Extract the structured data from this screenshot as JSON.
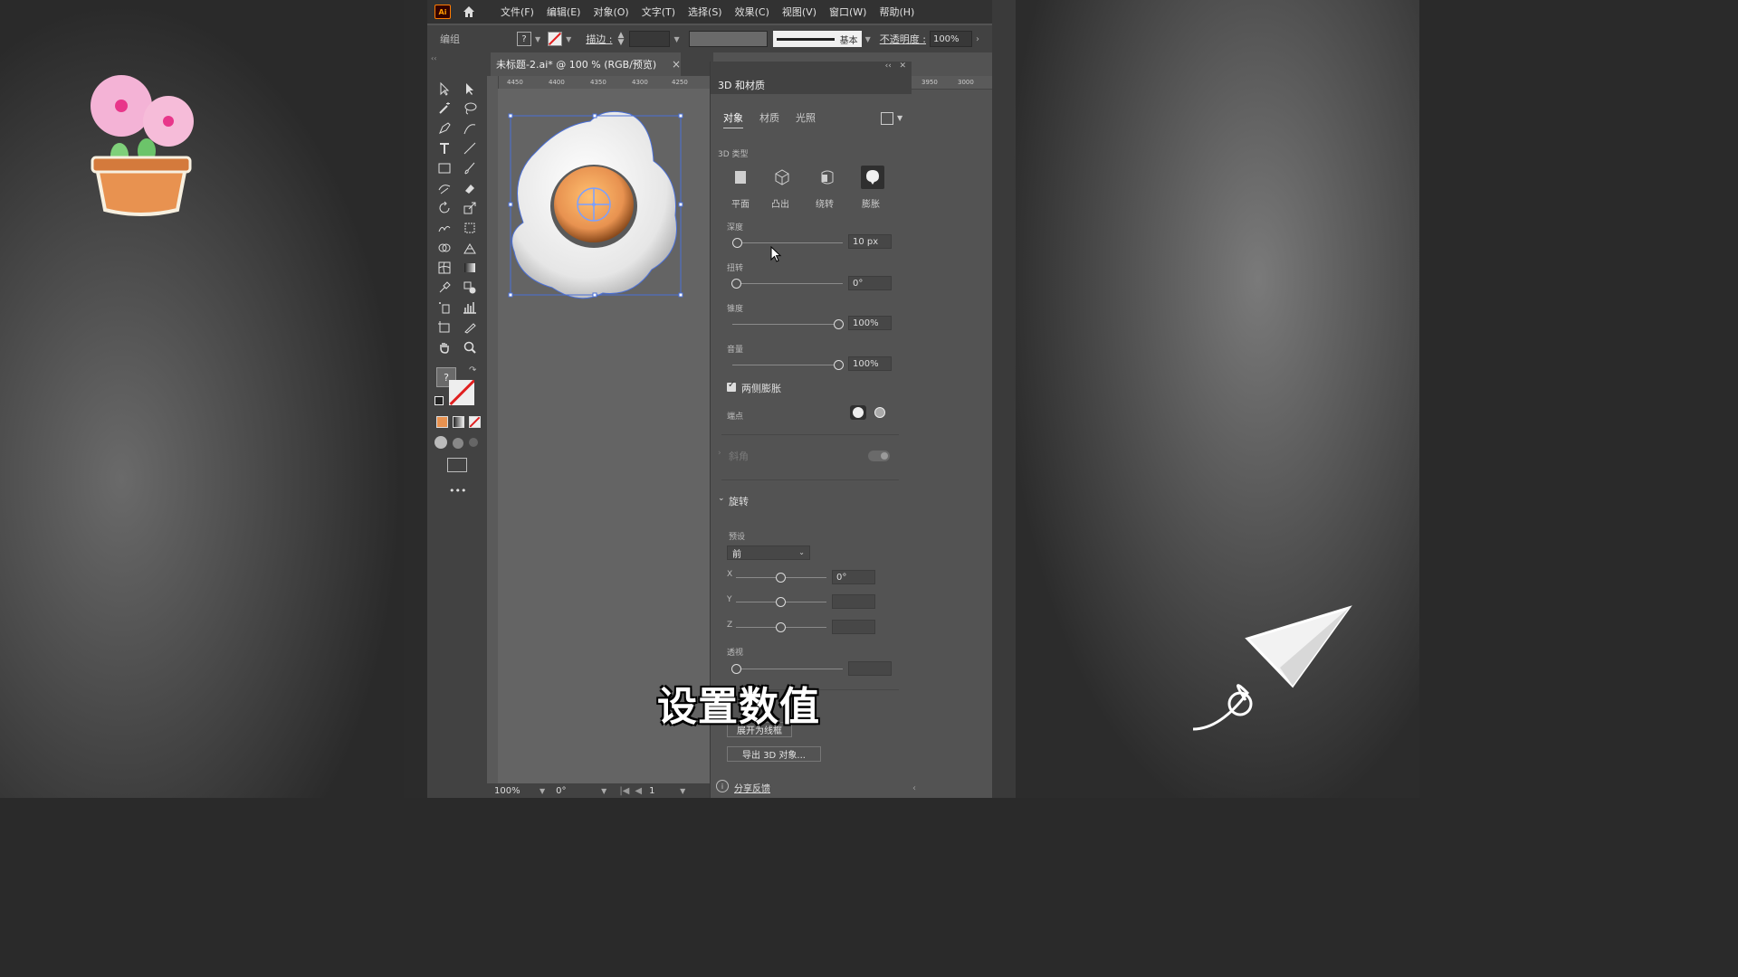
{
  "app": {
    "logo": "Ai",
    "menu": [
      "文件(F)",
      "编辑(E)",
      "对象(O)",
      "文字(T)",
      "选择(S)",
      "效果(C)",
      "视图(V)",
      "窗口(W)",
      "帮助(H)"
    ]
  },
  "control_bar": {
    "selection_label": "编组",
    "question": "?",
    "stroke_label": "描边 :",
    "stroke_style": "基本",
    "opacity_label": "不透明度 :",
    "opacity_value": "100%"
  },
  "document": {
    "tab_title": "未标题-2.ai* @ 100 % (RGB/预览)",
    "close": "×",
    "ruler_ticks": [
      "4450",
      "4400",
      "4350",
      "4300",
      "4250",
      "3950",
      "3000"
    ]
  },
  "status_bar": {
    "zoom": "100%",
    "rotation": "0°",
    "page": "1"
  },
  "toolbar": {
    "fill_stroke_question": "?",
    "more": "•••"
  },
  "panel": {
    "title": "3D 和材质",
    "tabs": [
      "对象",
      "材质",
      "光照"
    ],
    "type_section_label": "3D 类型",
    "types": [
      "平面",
      "凸出",
      "绕转",
      "膨胀"
    ],
    "active_type": "膨胀",
    "depth_label": "深度",
    "depth_value": "10 px",
    "twist_label": "扭转",
    "twist_value": "0°",
    "taper_label": "锥度",
    "taper_value": "100%",
    "volume_label": "音量",
    "volume_value": "100%",
    "both_sides_label": "两侧膨胀",
    "both_sides_checked": true,
    "cap_label": "端点",
    "bevel_label": "斜角",
    "rotation_section": "旋转",
    "preset_label": "预设",
    "preset_value": "前",
    "x_label": "X",
    "x_value": "0°",
    "y_label": "Y",
    "z_label": "Z",
    "perspective_label": "透视",
    "expand_button": "展开为线框",
    "export_button": "导出 3D 对象...",
    "feedback_link": "分享反馈"
  },
  "subtitle": "设置数值",
  "colors": {
    "accent_orange": "#e8a24a",
    "selection_blue": "#4a6fd6",
    "panel_bg": "#535353"
  }
}
